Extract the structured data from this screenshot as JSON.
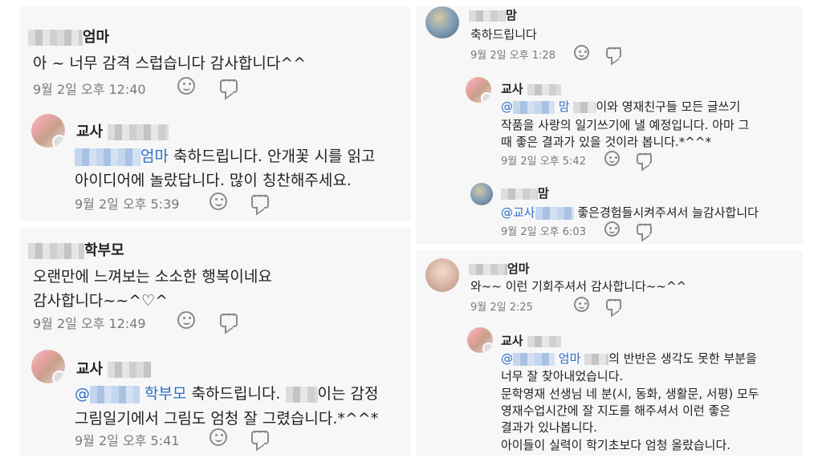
{
  "left": {
    "c1": {
      "name": "엄마",
      "text": "아 ~  너무  감격 스럽습니다   감사합니다^^",
      "time": "9월 2일 오후 12:40"
    },
    "c2": {
      "name_prefix": "교사",
      "mention": "엄마",
      "line1": " 축하드립니다. 안개꽃 시를 읽고",
      "line2": "아이디어에 놀랐답니다. 많이 칭찬해주세요.",
      "time": "9월 2일 오후 5:39"
    },
    "c3": {
      "name": "학부모",
      "line1": "오랜만에 느껴보는 소소한 행복이네요",
      "line2": "감사합니다~~^♡^",
      "time": "9월 2일 오후 12:49"
    },
    "c4": {
      "name_prefix": "교사",
      "mention_at": "@",
      "mention": "학부모",
      "line1a": " 축하드립니다. ",
      "line1b": "이는 감정",
      "line2": "그림일기에서 그림도 엄청 잘 그렸습니다.*^^*",
      "time": "9월 2일 오후 5:41"
    }
  },
  "right": {
    "c1": {
      "name": "맘",
      "text": "축하드립니다",
      "time": "9월 2일 오후 1:28"
    },
    "c2": {
      "name_prefix": "교사",
      "mention_at": "@",
      "mention": "맘",
      "line1b": "이와 영재친구들 모든 글쓰기",
      "line2": "작품을 사랑의 일기쓰기에 낼 예정입니다. 아마 그",
      "line3": "때 좋은 결과가 있을 것이라 봅니다.*^^*",
      "time": "9월 2일 오후 5:42"
    },
    "c3": {
      "name": "맘",
      "mention": "@교사",
      "line1b": " 좋은경험들시켜주셔서 늘감사합니다",
      "time": "9월 2일 오후 6:03"
    },
    "c4": {
      "name": "엄마",
      "text": "와~~ 이런 기회주셔서 감사합니다~~^^",
      "time": "9월 2일 2:25"
    },
    "c5": {
      "name_prefix": "교사",
      "mention_at": "@",
      "mention": "엄마",
      "line1b": "의 반반은 생각도 못한 부분을",
      "line2": "너무 잘 찾아내었습니다.",
      "line3": "문학영재 선생님 네 분(시, 동화, 생활문, 서평) 모두",
      "line4": "영재수업시간에 잘 지도를 해주셔서 이런 좋은",
      "line5": "결과가 있나봅니다.",
      "line6": "아이들이 실력이 학기초보다 엄청 올랐습니다."
    }
  }
}
